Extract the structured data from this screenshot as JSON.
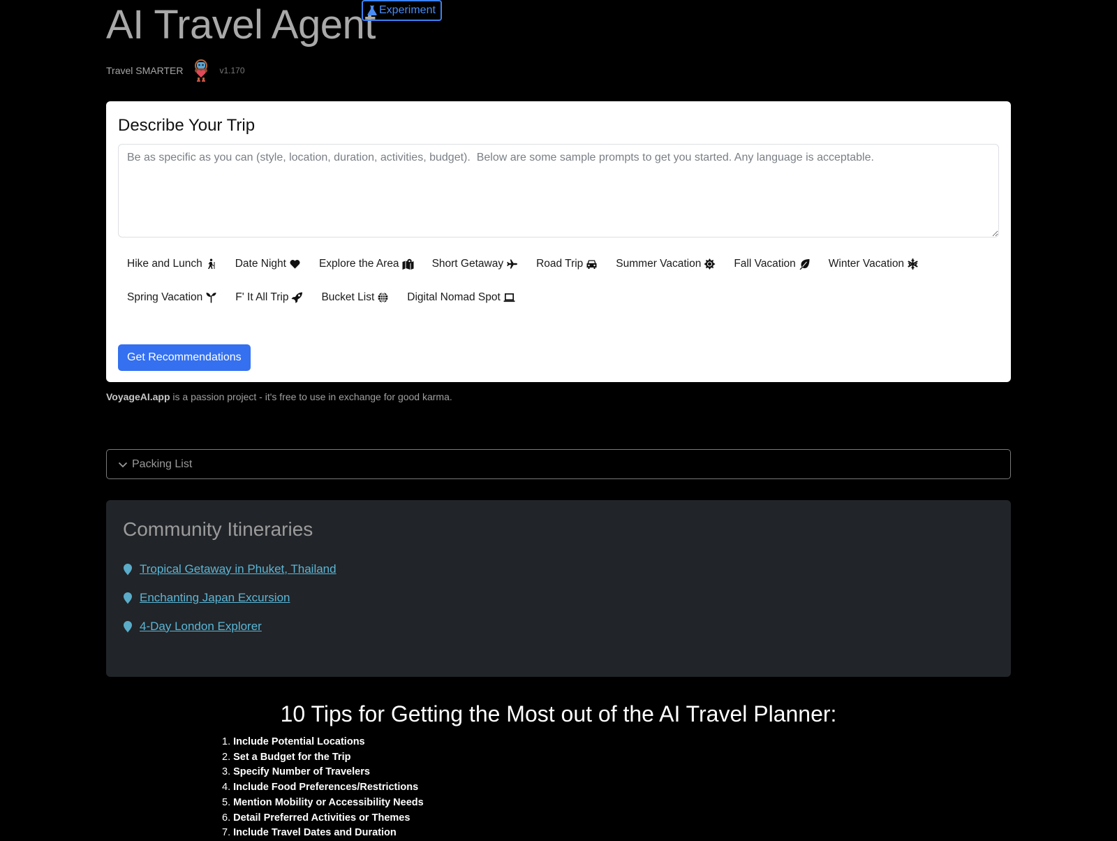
{
  "header": {
    "title": "AI Travel Agent",
    "badge": "Experiment",
    "tagline": "Travel SMARTER",
    "version": "v1.170"
  },
  "trip_card": {
    "title": "Describe Your Trip",
    "input_value": "",
    "input_placeholder": "Be as specific as you can (style, location, duration, activities, budget).  Below are some sample prompts to get you started. Any language is acceptable.",
    "prompts": [
      {
        "label": "Hike and Lunch",
        "icon": "hiking-icon"
      },
      {
        "label": "Date Night",
        "icon": "heart-icon"
      },
      {
        "label": "Explore the Area",
        "icon": "map-location-icon"
      },
      {
        "label": "Short Getaway",
        "icon": "plane-icon"
      },
      {
        "label": "Road Trip",
        "icon": "car-icon"
      },
      {
        "label": "Summer Vacation",
        "icon": "sun-icon"
      },
      {
        "label": "Fall Vacation",
        "icon": "leaf-icon"
      },
      {
        "label": "Winter Vacation",
        "icon": "snowflake-icon"
      },
      {
        "label": "Spring Vacation",
        "icon": "seedling-icon"
      },
      {
        "label": "F' It All Trip",
        "icon": "rocket-icon"
      },
      {
        "label": "Bucket List",
        "icon": "globe-icon"
      },
      {
        "label": "Digital Nomad Spot",
        "icon": "laptop-icon"
      }
    ],
    "submit_label": "Get Recommendations"
  },
  "footnote": {
    "brand": "VoyageAI.app",
    "text": " is a passion project - it's free to use in exchange for good karma."
  },
  "packing_list": {
    "label": "Packing List",
    "expanded": false
  },
  "community": {
    "title": "Community Itineraries",
    "items": [
      "Tropical Getaway in Phuket, Thailand",
      "Enchanting Japan Excursion",
      "4-Day London Explorer"
    ]
  },
  "tips": {
    "title": "10 Tips for Getting the Most out of the AI Travel Planner:",
    "items": [
      "Include Potential Locations",
      "Set a Budget for the Trip",
      "Specify Number of Travelers",
      "Include Food Preferences/Restrictions",
      "Mention Mobility or Accessibility Needs",
      "Detail Preferred Activities or Themes",
      "Include Travel Dates and Duration"
    ]
  },
  "colors": {
    "accent": "#3470f0",
    "badge": "#3b82f6",
    "link": "#5bb6d6",
    "panel": "#212428"
  }
}
